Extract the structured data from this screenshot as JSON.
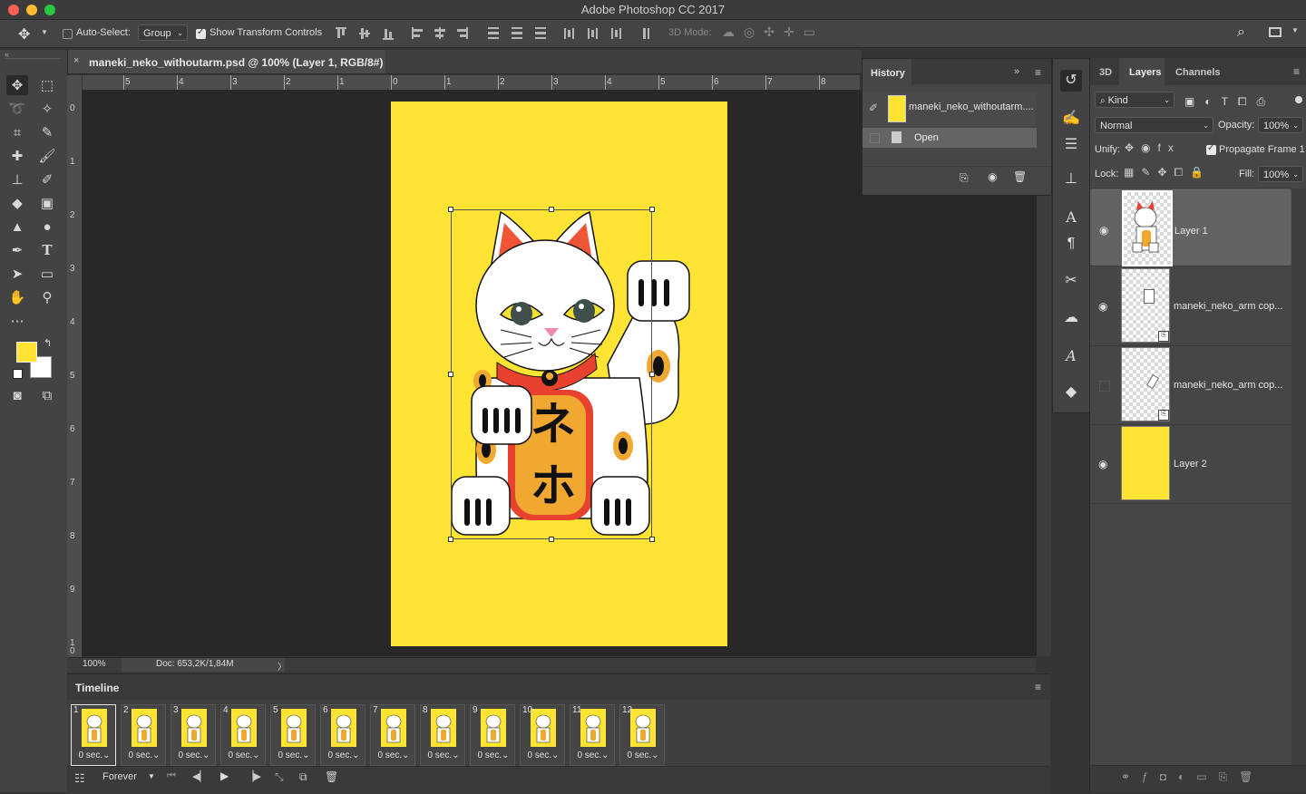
{
  "window": {
    "title": "Adobe Photoshop CC 2017"
  },
  "options": {
    "auto_select_label": "Auto-Select:",
    "auto_select_value": "Group",
    "show_transform_label": "Show Transform Controls",
    "mode3d_label": "3D Mode:"
  },
  "document": {
    "tab_label": "maneki_neko_withoutarm.psd @ 100% (Layer 1, RGB/8#)",
    "zoom": "100%",
    "doc_info": "Doc: 653,2K/1,84M",
    "hruler": [
      "5",
      "4",
      "3",
      "2",
      "1",
      "0",
      "1",
      "2",
      "3",
      "4",
      "5",
      "6",
      "7",
      "8"
    ],
    "vruler": [
      "0",
      "1",
      "2",
      "3",
      "4",
      "5",
      "6",
      "7",
      "8",
      "9",
      "1\n0"
    ]
  },
  "artwork": {
    "kanji_top": "ネ",
    "kanji_bottom": "ホ"
  },
  "history": {
    "title": "History",
    "snapshot_name": "maneki_neko_withoutarm....",
    "step": "Open"
  },
  "timeline": {
    "title": "Timeline",
    "loop": "Forever",
    "frames": [
      {
        "num": "1",
        "dur": "0 sec."
      },
      {
        "num": "2",
        "dur": "0 sec."
      },
      {
        "num": "3",
        "dur": "0 sec."
      },
      {
        "num": "4",
        "dur": "0 sec."
      },
      {
        "num": "5",
        "dur": "0 sec."
      },
      {
        "num": "6",
        "dur": "0 sec."
      },
      {
        "num": "7",
        "dur": "0 sec."
      },
      {
        "num": "8",
        "dur": "0 sec."
      },
      {
        "num": "9",
        "dur": "0 sec."
      },
      {
        "num": "10",
        "dur": "0 sec."
      },
      {
        "num": "11",
        "dur": "0 sec."
      },
      {
        "num": "12",
        "dur": "0 sec."
      }
    ]
  },
  "layers_panel": {
    "tabs": [
      "3D",
      "Layers",
      "Channels"
    ],
    "filter": "Kind",
    "blend_mode": "Normal",
    "opacity_label": "Opacity:",
    "opacity": "100%",
    "unify_label": "Unify:",
    "propagate_label": "Propagate Frame 1",
    "lock_label": "Lock:",
    "fill_label": "Fill:",
    "fill": "100%",
    "layers": [
      {
        "name": "Layer 1"
      },
      {
        "name": "maneki_neko_arm cop..."
      },
      {
        "name": "maneki_neko_arm cop..."
      },
      {
        "name": "Layer 2"
      }
    ]
  },
  "colors": {
    "canvas": "#ffe433",
    "foreground": "#ffe433",
    "background": "#ffffff"
  }
}
